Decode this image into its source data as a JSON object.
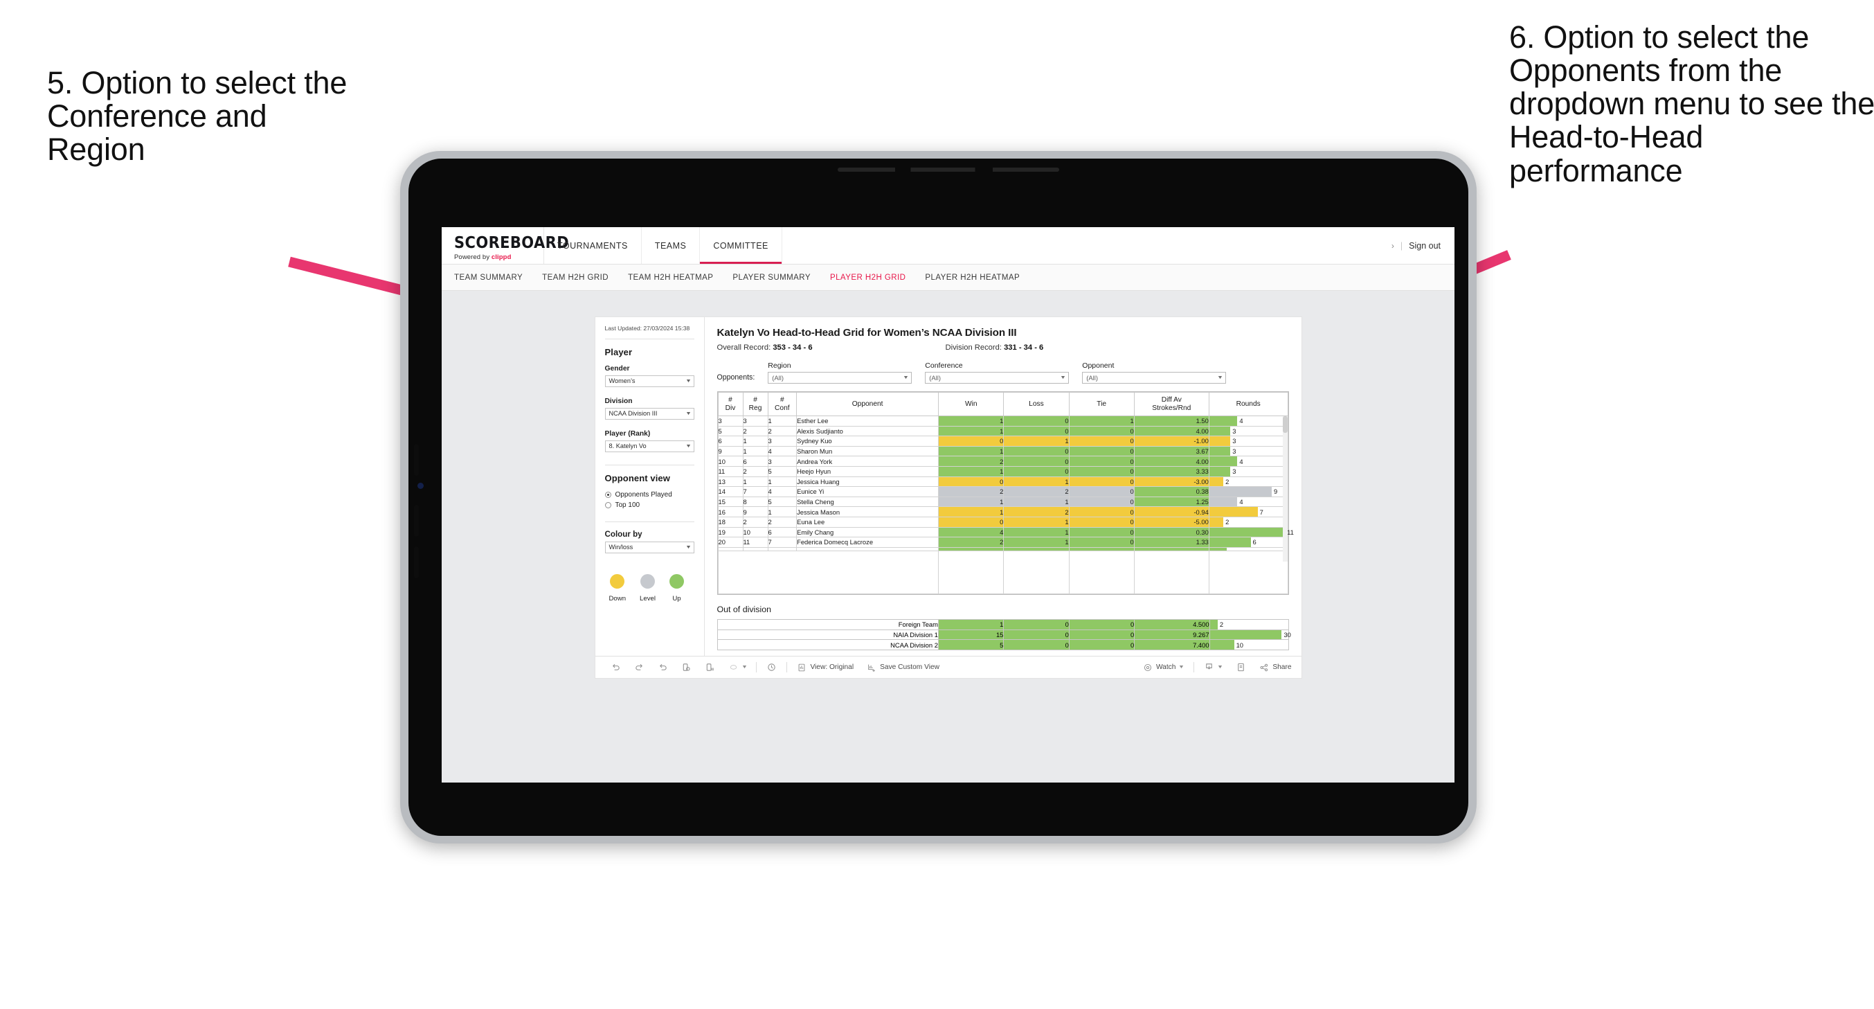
{
  "annotations": {
    "left": "5. Option to select the Conference and Region",
    "right": "6. Option to select the Opponents from the dropdown menu to see the Head-to-Head performance",
    "arrow_color": "#e8366f"
  },
  "app": {
    "brand": {
      "title": "SCOREBOARD",
      "powered_prefix": "Powered by ",
      "powered_brand": "clippd"
    },
    "topnav": [
      {
        "label": "TOURNAMENTS",
        "active": false
      },
      {
        "label": "TEAMS",
        "active": false
      },
      {
        "label": "COMMITTEE",
        "active": true
      }
    ],
    "signout": {
      "chevron": "›",
      "divider": "|",
      "label": "Sign out"
    },
    "subnav": [
      {
        "label": "TEAM SUMMARY",
        "active": false
      },
      {
        "label": "TEAM H2H GRID",
        "active": false
      },
      {
        "label": "TEAM H2H HEATMAP",
        "active": false
      },
      {
        "label": "PLAYER SUMMARY",
        "active": false
      },
      {
        "label": "PLAYER H2H GRID",
        "active": true
      },
      {
        "label": "PLAYER H2H HEATMAP",
        "active": false
      }
    ]
  },
  "sidebar": {
    "last_updated": "Last Updated: 27/03/2024 15:38",
    "player_heading": "Player",
    "selects": [
      {
        "label": "Gender",
        "value": "Women’s"
      },
      {
        "label": "Division",
        "value": "NCAA Division III"
      },
      {
        "label": "Player (Rank)",
        "value": "8. Katelyn Vo"
      }
    ],
    "opponent_view": {
      "heading": "Opponent view",
      "options": [
        {
          "label": "Opponents Played",
          "selected": true
        },
        {
          "label": "Top 100",
          "selected": false
        }
      ]
    },
    "colour_by": {
      "label": "Colour by",
      "value": "Win/loss"
    },
    "legend": [
      {
        "label": "Down",
        "color": "#f2cb3d"
      },
      {
        "label": "Level",
        "color": "#c6c9ce"
      },
      {
        "label": "Up",
        "color": "#8fc864"
      }
    ]
  },
  "viz": {
    "title": "Katelyn Vo Head-to-Head Grid for Women’s NCAA Division III",
    "overall_record_label": "Overall Record:",
    "overall_record_value": "353 - 34 - 6",
    "division_record_label": "Division Record:",
    "division_record_value": "331 - 34 - 6",
    "opponents_label": "Opponents:",
    "filters": [
      {
        "label": "Region",
        "value": "(All)"
      },
      {
        "label": "Conference",
        "value": "(All)"
      },
      {
        "label": "Opponent",
        "value": "(All)"
      }
    ],
    "columns": [
      "# Div",
      "# Reg",
      "# Conf",
      "Opponent",
      "Win",
      "Loss",
      "Tie",
      "Diff Av Strokes/Rnd",
      "Rounds"
    ],
    "column_lines": [
      [
        "#",
        "Div"
      ],
      [
        "#",
        "Reg"
      ],
      [
        "#",
        "Conf"
      ],
      [
        "Opponent",
        ""
      ],
      [
        "Win",
        ""
      ],
      [
        "Loss",
        ""
      ],
      [
        "Tie",
        ""
      ],
      [
        "Diff Av",
        "Strokes/Rnd"
      ],
      [
        "Rounds",
        ""
      ]
    ],
    "rows": [
      {
        "div": "3",
        "reg": "3",
        "conf": "1",
        "opponent": "Esther Lee",
        "win": "1",
        "loss": "0",
        "tie": "1",
        "diff": "1.50",
        "rounds": "4",
        "rounds_pct": 36,
        "color": "#8fc864"
      },
      {
        "div": "5",
        "reg": "2",
        "conf": "2",
        "opponent": "Alexis Sudjianto",
        "win": "1",
        "loss": "0",
        "tie": "0",
        "diff": "4.00",
        "rounds": "3",
        "rounds_pct": 27,
        "color": "#8fc864"
      },
      {
        "div": "6",
        "reg": "1",
        "conf": "3",
        "opponent": "Sydney Kuo",
        "win": "0",
        "loss": "1",
        "tie": "0",
        "diff": "-1.00",
        "rounds": "3",
        "rounds_pct": 27,
        "color": "#f2cb3d"
      },
      {
        "div": "9",
        "reg": "1",
        "conf": "4",
        "opponent": "Sharon Mun",
        "win": "1",
        "loss": "0",
        "tie": "0",
        "diff": "3.67",
        "rounds": "3",
        "rounds_pct": 27,
        "color": "#8fc864"
      },
      {
        "div": "10",
        "reg": "6",
        "conf": "3",
        "opponent": "Andrea York",
        "win": "2",
        "loss": "0",
        "tie": "0",
        "diff": "4.00",
        "rounds": "4",
        "rounds_pct": 36,
        "color": "#8fc864"
      },
      {
        "div": "11",
        "reg": "2",
        "conf": "5",
        "opponent": "Heejo Hyun",
        "win": "1",
        "loss": "0",
        "tie": "0",
        "diff": "3.33",
        "rounds": "3",
        "rounds_pct": 27,
        "color": "#8fc864"
      },
      {
        "div": "13",
        "reg": "1",
        "conf": "1",
        "opponent": "Jessica Huang",
        "win": "0",
        "loss": "1",
        "tie": "0",
        "diff": "-3.00",
        "rounds": "2",
        "rounds_pct": 18,
        "color": "#f2cb3d"
      },
      {
        "div": "14",
        "reg": "7",
        "conf": "4",
        "opponent": "Eunice Yi",
        "win": "2",
        "loss": "2",
        "tie": "0",
        "diff": "0.38",
        "rounds": "9",
        "rounds_pct": 80,
        "color": "#c6c9ce",
        "diff_color": "#8fc864"
      },
      {
        "div": "15",
        "reg": "8",
        "conf": "5",
        "opponent": "Stella Cheng",
        "win": "1",
        "loss": "1",
        "tie": "0",
        "diff": "1.25",
        "rounds": "4",
        "rounds_pct": 36,
        "color": "#c6c9ce",
        "diff_color": "#8fc864"
      },
      {
        "div": "16",
        "reg": "9",
        "conf": "1",
        "opponent": "Jessica Mason",
        "win": "1",
        "loss": "2",
        "tie": "0",
        "diff": "-0.94",
        "rounds": "7",
        "rounds_pct": 62,
        "color": "#f2cb3d"
      },
      {
        "div": "18",
        "reg": "2",
        "conf": "2",
        "opponent": "Euna Lee",
        "win": "0",
        "loss": "1",
        "tie": "0",
        "diff": "-5.00",
        "rounds": "2",
        "rounds_pct": 18,
        "color": "#f2cb3d"
      },
      {
        "div": "19",
        "reg": "10",
        "conf": "6",
        "opponent": "Emily Chang",
        "win": "4",
        "loss": "1",
        "tie": "0",
        "diff": "0.30",
        "rounds": "11",
        "rounds_pct": 97,
        "color": "#8fc864"
      },
      {
        "div": "20",
        "reg": "11",
        "conf": "7",
        "opponent": "Federica Domecq Lacroze",
        "win": "2",
        "loss": "1",
        "tie": "0",
        "diff": "1.33",
        "rounds": "6",
        "rounds_pct": 53,
        "color": "#8fc864"
      }
    ],
    "out_of_division": {
      "title": "Out of division",
      "rows": [
        {
          "name": "Foreign Team",
          "win": "1",
          "loss": "0",
          "tie": "0",
          "diff": "4.500",
          "rounds": "2",
          "rounds_pct": 10,
          "color": "#8fc864"
        },
        {
          "name": "NAIA Division 1",
          "win": "15",
          "loss": "0",
          "tie": "0",
          "diff": "9.267",
          "rounds": "30",
          "rounds_pct": 92,
          "color": "#8fc864"
        },
        {
          "name": "NCAA Division 2",
          "win": "5",
          "loss": "0",
          "tie": "0",
          "diff": "7.400",
          "rounds": "10",
          "rounds_pct": 31,
          "color": "#8fc864"
        }
      ]
    }
  },
  "toolbar": {
    "view_label": "View: Original",
    "save_label": "Save Custom View",
    "watch_label": "Watch",
    "share_label": "Share"
  },
  "chart_data": {
    "type": "table",
    "title": "Katelyn Vo Head-to-Head Grid for Women’s NCAA Division III",
    "columns": [
      "# Div",
      "# Reg",
      "# Conf",
      "Opponent",
      "Win",
      "Loss",
      "Tie",
      "Diff Av Strokes/Rnd",
      "Rounds"
    ],
    "rows": [
      [
        3,
        3,
        1,
        "Esther Lee",
        1,
        0,
        1,
        1.5,
        4
      ],
      [
        5,
        2,
        2,
        "Alexis Sudjianto",
        1,
        0,
        0,
        4.0,
        3
      ],
      [
        6,
        1,
        3,
        "Sydney Kuo",
        0,
        1,
        0,
        -1.0,
        3
      ],
      [
        9,
        1,
        4,
        "Sharon Mun",
        1,
        0,
        0,
        3.67,
        3
      ],
      [
        10,
        6,
        3,
        "Andrea York",
        2,
        0,
        0,
        4.0,
        4
      ],
      [
        11,
        2,
        5,
        "Heejo Hyun",
        1,
        0,
        0,
        3.33,
        3
      ],
      [
        13,
        1,
        1,
        "Jessica Huang",
        0,
        1,
        0,
        -3.0,
        2
      ],
      [
        14,
        7,
        4,
        "Eunice Yi",
        2,
        2,
        0,
        0.38,
        9
      ],
      [
        15,
        8,
        5,
        "Stella Cheng",
        1,
        1,
        0,
        1.25,
        4
      ],
      [
        16,
        9,
        1,
        "Jessica Mason",
        1,
        2,
        0,
        -0.94,
        7
      ],
      [
        18,
        2,
        2,
        "Euna Lee",
        0,
        1,
        0,
        -5.0,
        2
      ],
      [
        19,
        10,
        6,
        "Emily Chang",
        4,
        1,
        0,
        0.3,
        11
      ],
      [
        20,
        11,
        7,
        "Federica Domecq Lacroze",
        2,
        1,
        0,
        1.33,
        6
      ]
    ],
    "out_of_division_rows": [
      [
        "Foreign Team",
        1,
        0,
        0,
        4.5,
        2
      ],
      [
        "NAIA Division 1",
        15,
        0,
        0,
        9.267,
        30
      ],
      [
        "NCAA Division 2",
        5,
        0,
        0,
        7.4,
        10
      ]
    ],
    "colour_legend": {
      "Down": "#f2cb3d",
      "Level": "#c6c9ce",
      "Up": "#8fc864"
    },
    "overall_record": "353 - 34 - 6",
    "division_record": "331 - 34 - 6"
  }
}
